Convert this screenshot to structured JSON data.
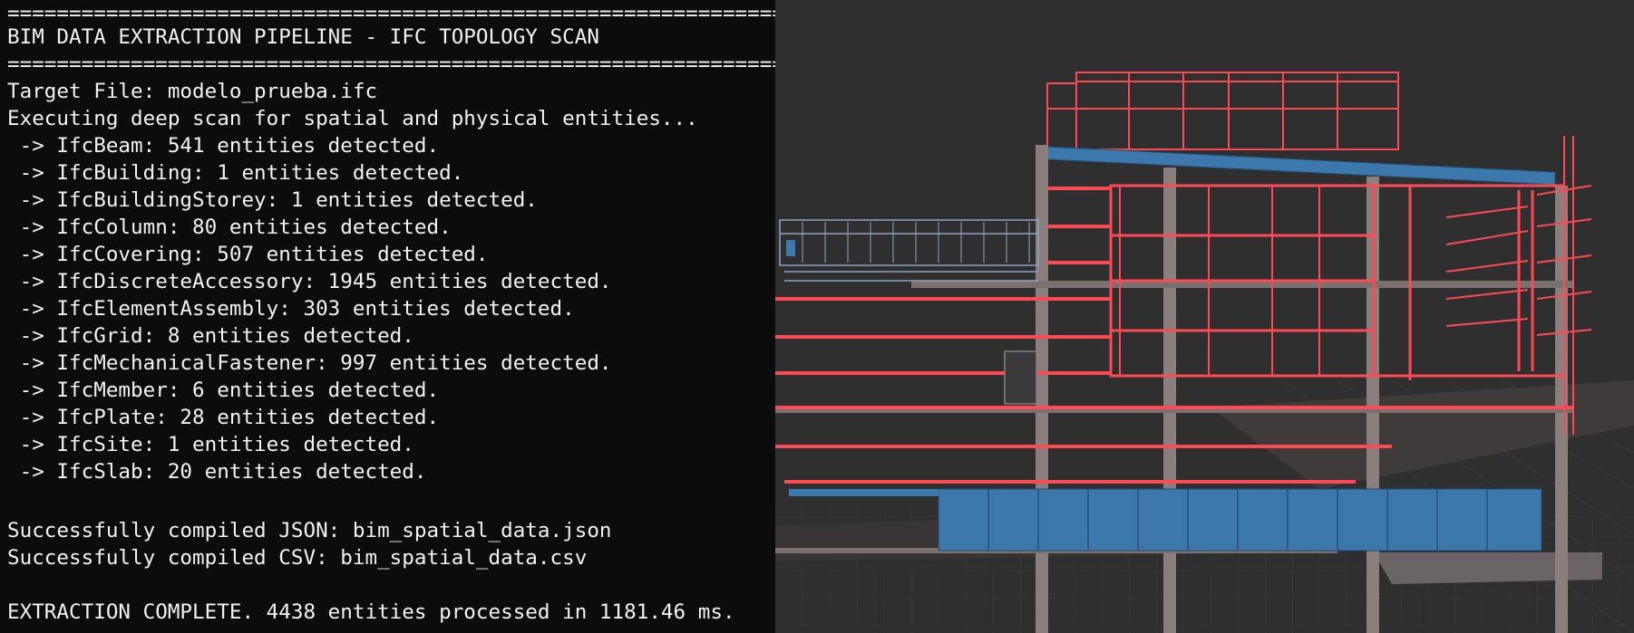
{
  "terminal": {
    "separator": "=======================================================================",
    "title": "BIM DATA EXTRACTION PIPELINE - IFC TOPOLOGY SCAN",
    "target_file": "Target File: modelo_prueba.ifc",
    "status": "Executing deep scan for spatial and physical entities...",
    "entities": [
      " -> IfcBeam: 541 entities detected.",
      " -> IfcBuilding: 1 entities detected.",
      " -> IfcBuildingStorey: 1 entities detected.",
      " -> IfcColumn: 80 entities detected.",
      " -> IfcCovering: 507 entities detected.",
      " -> IfcDiscreteAccessory: 1945 entities detected.",
      " -> IfcElementAssembly: 303 entities detected.",
      " -> IfcGrid: 8 entities detected.",
      " -> IfcMechanicalFastener: 997 entities detected.",
      " -> IfcMember: 6 entities detected.",
      " -> IfcPlate: 28 entities detected.",
      " -> IfcSite: 1 entities detected.",
      " -> IfcSlab: 20 entities detected."
    ],
    "json_output": "Successfully compiled JSON: bim_spatial_data.json",
    "csv_output": "Successfully compiled CSV: bim_spatial_data.csv",
    "complete": "EXTRACTION COMPLETE. 4438 entities processed in 1181.46 ms."
  },
  "colors": {
    "terminal_bg": "#0c0c0c",
    "terminal_fg": "#f2f2f2",
    "viewport_bg": "#2f2f30",
    "highlight_red": "#ff4a55",
    "beam_blue": "#3d78ad",
    "column_gray": "#8a7f7d"
  }
}
